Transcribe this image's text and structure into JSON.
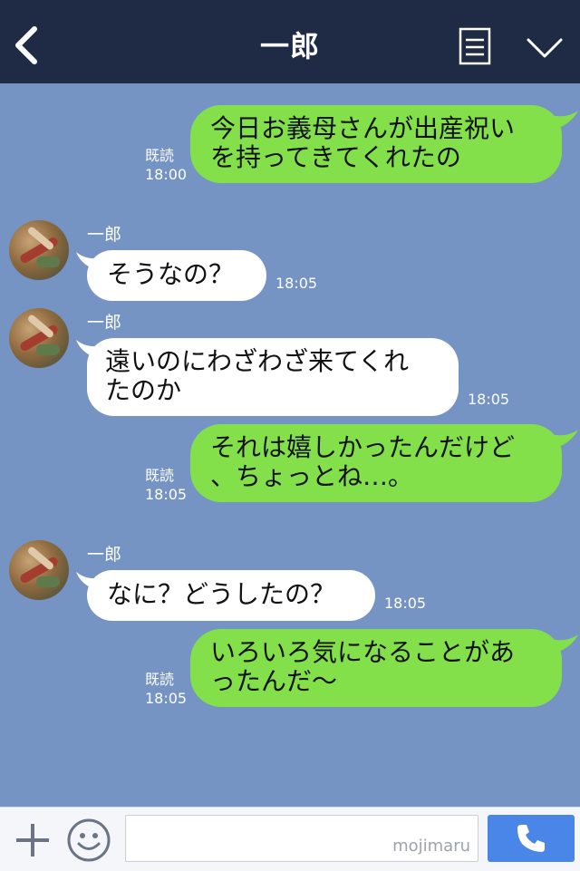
{
  "header": {
    "title": "一郎",
    "back_icon": "chevron-left-icon",
    "menu_icon": "note-icon",
    "expand_icon": "chevron-down-icon"
  },
  "messages": [
    {
      "side": "me",
      "text": "今日お義母さんが出産祝い\nを持ってきてくれたの",
      "read": "既読",
      "time": "18:00"
    },
    {
      "side": "other",
      "sender": "一郎",
      "text": "そうなの？",
      "time": "18:05"
    },
    {
      "side": "other",
      "sender": "一郎",
      "text": "遠いのにわざわざ来てくれ\nたのか",
      "time": "18:05"
    },
    {
      "side": "me",
      "text": "それは嬉しかったんだけど\n、ちょっとね…。",
      "read": "既読",
      "time": "18:05"
    },
    {
      "side": "other",
      "sender": "一郎",
      "text": "なに？どうしたの？",
      "time": "18:05"
    },
    {
      "side": "me",
      "text": "いろいろ気になることがあ\nったんだ〜",
      "read": "既読",
      "time": "18:05"
    }
  ],
  "footer": {
    "plus_icon": "plus-icon",
    "emoji_icon": "smiley-icon",
    "input_value": "",
    "watermark": "mojimaru",
    "call_icon": "phone-icon"
  },
  "colors": {
    "header_bg": "#1f2b45",
    "chat_bg": "#7593c3",
    "my_bubble": "#83e04a",
    "their_bubble": "#ffffff",
    "call_button": "#4a86e8"
  }
}
